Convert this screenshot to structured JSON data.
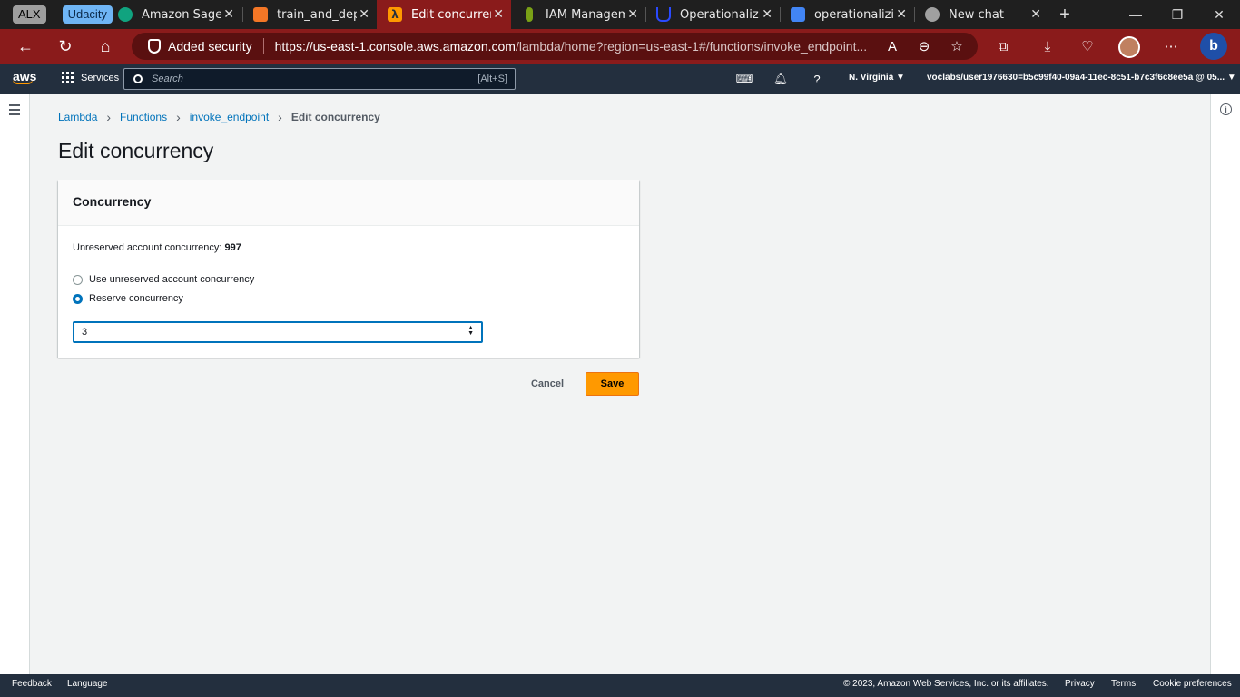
{
  "browser": {
    "tab_groups": [
      "ALX",
      "Udacity"
    ],
    "tabs": [
      {
        "label": "Amazon SageMaker",
        "icon": "chatgpt-icon",
        "color": "#10a37f"
      },
      {
        "label": "train_and_deploy",
        "icon": "notebook-icon",
        "color": "#f37626"
      },
      {
        "label": "Edit concurrency",
        "icon": "lambda-icon",
        "color": "#ff9900"
      },
      {
        "label": "IAM Management",
        "icon": "iam-icon",
        "color": "#7aa116"
      },
      {
        "label": "Operationalizing",
        "icon": "udacity-icon",
        "color": "#2015ff"
      },
      {
        "label": "operationalizing",
        "icon": "docs-icon",
        "color": "#4285f4"
      },
      {
        "label": "New chat",
        "icon": "chatgpt-icon",
        "color": "#a0a0a0"
      }
    ],
    "security_label": "Added security",
    "url_host": "https://us-east-1.console.aws.amazon.com",
    "url_path": "/lambda/home?region=us-east-1#/functions/invoke_endpoint..."
  },
  "aws": {
    "logo": "aws",
    "services_label": "Services",
    "search_placeholder": "Search",
    "search_shortcut": "[Alt+S]",
    "region": "N. Virginia ▼",
    "account": "voclabs/user1976630=b5c99f40-09a4-11ec-8c51-b7c3f6c8ee5a @ 05... ▼"
  },
  "breadcrumb": {
    "items": [
      "Lambda",
      "Functions",
      "invoke_endpoint"
    ],
    "current": "Edit concurrency"
  },
  "page_title": "Edit concurrency",
  "panel": {
    "header": "Concurrency",
    "unreserved_label": "Unreserved account concurrency:",
    "unreserved_value": "997",
    "options": [
      {
        "label": "Use unreserved account concurrency",
        "selected": false
      },
      {
        "label": "Reserve concurrency",
        "selected": true
      }
    ],
    "reserved_value": "3"
  },
  "actions": {
    "cancel": "Cancel",
    "save": "Save"
  },
  "footer": {
    "feedback": "Feedback",
    "language": "Language",
    "copyright": "© 2023, Amazon Web Services, Inc. or its affiliates.",
    "privacy": "Privacy",
    "terms": "Terms",
    "cookies": "Cookie preferences"
  },
  "colors": {
    "browser_accent": "#8a1b1b",
    "aws_nav": "#232f3e",
    "link": "#0073bb",
    "primary_button": "#ff9900"
  }
}
